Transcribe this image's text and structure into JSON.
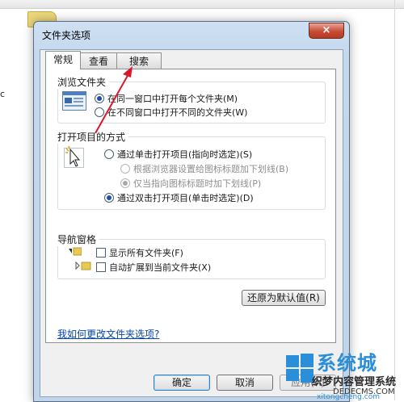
{
  "dialog": {
    "title": "文件夹选项",
    "close_glyph": "×"
  },
  "tabs": [
    {
      "label": "常规",
      "active": true
    },
    {
      "label": "查看",
      "active": false
    },
    {
      "label": "搜索",
      "active": false
    }
  ],
  "browse": {
    "title": "浏览文件夹",
    "options": [
      {
        "label": "在同一窗口中打开每个文件夹(M)",
        "checked": true
      },
      {
        "label": "在不同窗口中打开不同的文件夹(W)",
        "checked": false
      }
    ]
  },
  "open_items": {
    "title": "打开项目的方式",
    "single_click": "通过单击打开项目(指向时选定)(S)",
    "underline_browser": "根据浏览器设置给图标标题加下划线(B)",
    "underline_point": "仅当指向图标标题时加下划线(P)",
    "double_click": "通过双击打开项目(单击时选定)(D)"
  },
  "nav_pane": {
    "title": "导航窗格",
    "show_all": "显示所有文件夹(F)",
    "auto_expand": "自动扩展到当前文件夹(X)"
  },
  "restore_defaults": "还原为默认值(R)",
  "help_link": "我如何更改文件夹选项?",
  "buttons": {
    "ok": "确定",
    "cancel": "取消",
    "apply": "应用(A)"
  },
  "watermark": {
    "brand": "系统城",
    "site": "xitongcheng.com",
    "sub_brand": "织梦内容管理系统",
    "sub_site": "DEDECMS.COM"
  },
  "colors": {
    "accent_arrow": "#d8182a",
    "link": "#0645ad"
  }
}
